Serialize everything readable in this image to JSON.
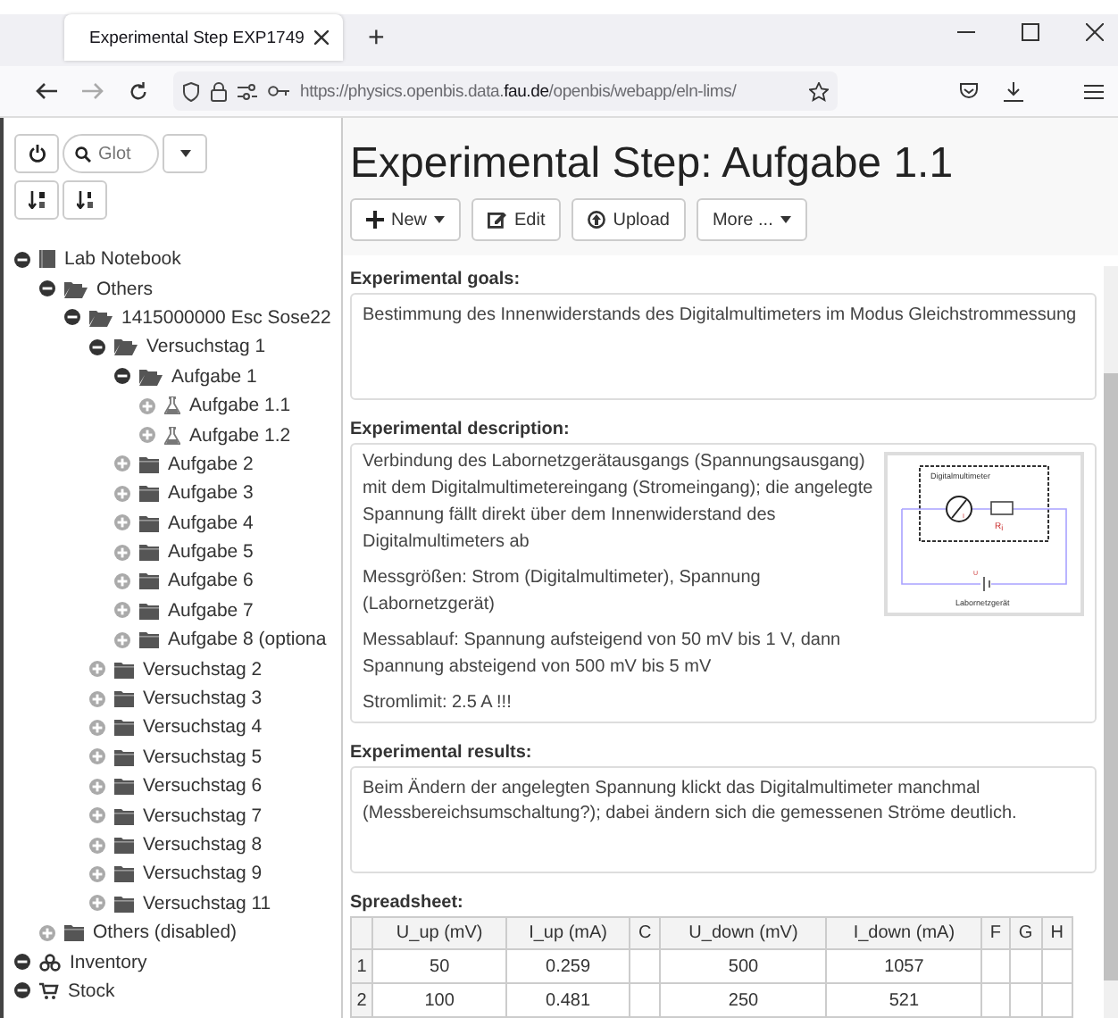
{
  "browser": {
    "tab_title": "Experimental Step EXP1749",
    "new_tab": "+",
    "url_prefix": "https://physics.openbis.data.",
    "url_domain": "fau.de",
    "url_suffix": "/openbis/webapp/eln-lims/"
  },
  "sidebar": {
    "search": {
      "placeholder": "Glot"
    },
    "tree": [
      {
        "label": "Lab Notebook",
        "kind": "notebook",
        "expanded": true,
        "children": [
          {
            "label": "Others",
            "kind": "folder",
            "expanded": true,
            "children": [
              {
                "label": "1415000000 Esc Sose22",
                "kind": "folder",
                "expanded": true,
                "children": [
                  {
                    "label": "Versuchstag 1",
                    "kind": "folder",
                    "expanded": true,
                    "children": [
                      {
                        "label": "Aufgabe 1",
                        "kind": "folder",
                        "expanded": true,
                        "children": [
                          {
                            "label": "Aufgabe 1.1",
                            "kind": "experiment",
                            "expanded": false
                          },
                          {
                            "label": "Aufgabe 1.2",
                            "kind": "experiment",
                            "expanded": false
                          }
                        ]
                      },
                      {
                        "label": "Aufgabe 2",
                        "kind": "folder",
                        "expanded": false
                      },
                      {
                        "label": "Aufgabe 3",
                        "kind": "folder",
                        "expanded": false
                      },
                      {
                        "label": "Aufgabe 4",
                        "kind": "folder",
                        "expanded": false
                      },
                      {
                        "label": "Aufgabe 5",
                        "kind": "folder",
                        "expanded": false
                      },
                      {
                        "label": "Aufgabe 6",
                        "kind": "folder",
                        "expanded": false
                      },
                      {
                        "label": "Aufgabe 7",
                        "kind": "folder",
                        "expanded": false
                      },
                      {
                        "label": "Aufgabe 8 (optiona",
                        "kind": "folder",
                        "expanded": false
                      }
                    ]
                  },
                  {
                    "label": "Versuchstag 2",
                    "kind": "folder",
                    "expanded": false
                  },
                  {
                    "label": "Versuchstag 3",
                    "kind": "folder",
                    "expanded": false
                  },
                  {
                    "label": "Versuchstag 4",
                    "kind": "folder",
                    "expanded": false
                  },
                  {
                    "label": "Versuchstag 5",
                    "kind": "folder",
                    "expanded": false
                  },
                  {
                    "label": "Versuchstag 6",
                    "kind": "folder",
                    "expanded": false
                  },
                  {
                    "label": "Versuchstag 7",
                    "kind": "folder",
                    "expanded": false
                  },
                  {
                    "label": "Versuchstag 8",
                    "kind": "folder",
                    "expanded": false
                  },
                  {
                    "label": "Versuchstag 9",
                    "kind": "folder",
                    "expanded": false
                  },
                  {
                    "label": "Versuchstag 11",
                    "kind": "folder",
                    "expanded": false
                  }
                ]
              }
            ]
          },
          {
            "label": "Others (disabled)",
            "kind": "folder",
            "expanded": false
          }
        ]
      },
      {
        "label": "Inventory",
        "kind": "inventory",
        "expanded": true
      },
      {
        "label": "Stock",
        "kind": "stock",
        "expanded": true
      }
    ]
  },
  "page": {
    "title": "Experimental Step: Aufgabe 1.1",
    "toolbar": [
      {
        "label": "New",
        "kind": "new",
        "dropdown": true
      },
      {
        "label": "Edit",
        "kind": "edit",
        "dropdown": false
      },
      {
        "label": "Upload",
        "kind": "upload",
        "dropdown": false
      },
      {
        "label": "More ...",
        "kind": "more",
        "dropdown": true
      }
    ],
    "goals": {
      "label": "Experimental goals:",
      "text": "Bestimmung des Innenwiderstands des Digitalmultimeters im Modus Gleichstrommessung"
    },
    "description": {
      "label": "Experimental description:",
      "paragraphs": [
        "Verbindung des Labornetzgerätausgangs (Spannungsausgang) mit dem Digitalmultimetereingang (Stromeingang); die angelegte Spannung fällt direkt über dem Innenwiderstand des Digitalmultimeters ab",
        "Messgrößen: Strom (Digitalmultimeter), Spannung (Labornetzgerät)",
        "Messablauf: Spannung aufsteigend von 50 mV bis 1 V, dann Spannung absteigend von 500 mV bis 5 mV",
        "Stromlimit: 2.5 A !!!"
      ],
      "diagram": {
        "meter_label": "Digitalmultimeter",
        "current": "I",
        "resistor": "R$_{i}$",
        "voltage": "U",
        "supply_label": "Labornetzgerät"
      }
    },
    "results": {
      "label": "Experimental results:",
      "text": "Beim Ändern der angelegten Spannung klickt das Digitalmultimeter manchmal (Messbereichsumschaltung?); dabei ändern sich die gemessenen Ströme deutlich."
    },
    "spreadsheet": {
      "label": "Spreadsheet:",
      "columns": [
        "U_up (mV)",
        "I_up (mA)",
        "C",
        "U_down (mV)",
        "I_down (mA)",
        "F",
        "G",
        "H"
      ],
      "rows": [
        {
          "number": "1",
          "cells": [
            "50",
            "0.259",
            "",
            "500",
            "1057",
            "",
            "",
            ""
          ]
        },
        {
          "number": "2",
          "cells": [
            "100",
            "0.481",
            "",
            "250",
            "521",
            "",
            "",
            ""
          ]
        }
      ]
    }
  }
}
